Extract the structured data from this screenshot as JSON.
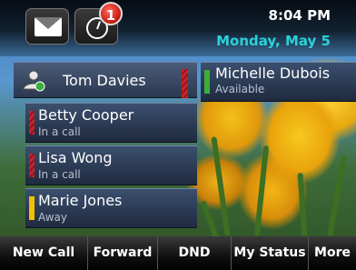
{
  "header": {
    "messages_icon": "envelope-icon",
    "history_icon": "clock-icon",
    "missed_badge": "1",
    "time": "8:04 PM",
    "date": "Monday, May 5"
  },
  "user": {
    "name": "Tom Davies",
    "icon": "user-phone-icon"
  },
  "contacts": [
    {
      "name": "Michelle Dubois",
      "status": "Available",
      "indicator": "green"
    },
    {
      "name": "Betty Cooper",
      "status": "In a call",
      "indicator": "red"
    },
    {
      "name": "Lisa Wong",
      "status": "In a call",
      "indicator": "red"
    },
    {
      "name": "Marie Jones",
      "status": "Away",
      "indicator": "yellow"
    }
  ],
  "softkeys": [
    "New Call",
    "Forward",
    "DND",
    "My Status",
    "More"
  ],
  "colors": {
    "available": "#3cae3a",
    "busy": "#c7242c",
    "away": "#f2c000",
    "date_accent": "#2bd1d8"
  }
}
